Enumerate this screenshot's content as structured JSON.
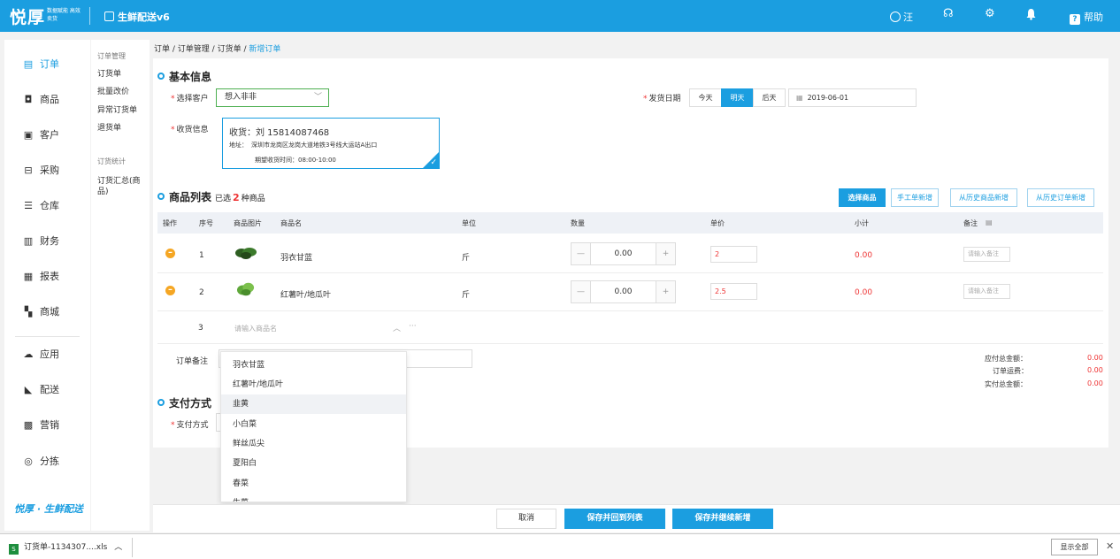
{
  "colors": {
    "brand": "#1b9ee0",
    "price_red": "#e33333",
    "remove_orange": "#f5a623",
    "selected_border": "#4caf50"
  },
  "topbar": {
    "logo": "悦厚",
    "logo_sub": "数据赋能 高效卖货",
    "app_title": "生鲜配送v6",
    "user_icon": "user-circle-icon",
    "user": "汪",
    "help": "帮助"
  },
  "sidebar": {
    "items": [
      {
        "label": "订单",
        "icon": "order-icon"
      },
      {
        "label": "商品",
        "icon": "bag-icon"
      },
      {
        "label": "客户",
        "icon": "contact-icon"
      },
      {
        "label": "采购",
        "icon": "cart-icon"
      },
      {
        "label": "仓库",
        "icon": "warehouse-icon"
      },
      {
        "label": "财务",
        "icon": "finance-icon"
      },
      {
        "label": "报表",
        "icon": "chart-icon"
      },
      {
        "label": "商城",
        "icon": "store-icon"
      },
      {
        "label": "应用",
        "icon": "cloud-icon"
      },
      {
        "label": "配送",
        "icon": "send-icon"
      },
      {
        "label": "营销",
        "icon": "marketing-icon"
      },
      {
        "label": "分拣",
        "icon": "sort-icon"
      }
    ],
    "brand": "悦厚 · 生鲜配送"
  },
  "subnav": {
    "group1": "订单管理",
    "items1": [
      "订货单",
      "批量改价",
      "异常订货单",
      "退货单"
    ],
    "group2": "订货统计",
    "items2": [
      "订货汇总(商品)"
    ]
  },
  "breadcrumb": [
    "订单",
    "订单管理",
    "订货单",
    "新增订单"
  ],
  "basic": {
    "title": "基本信息",
    "customer_label": "选择客户",
    "customer_value": "想入非非",
    "date_label": "发货日期",
    "date_options": [
      "今天",
      "明天",
      "后天"
    ],
    "date_selected": "明天",
    "date_value": "2019-06-01",
    "receive_label": "收货信息",
    "receiver": "收货：刘 15814087468",
    "address_label": "地址：",
    "address": "深圳市龙岗区龙岗大道地铁3号线大运站A出口",
    "expect_time": "期望收货时间：08:00-10:00"
  },
  "products": {
    "title": "商品列表",
    "selected_prefix": "已选",
    "selected_count": "2",
    "selected_suffix": "种商品",
    "buttons": [
      "选择商品",
      "手工单新增",
      "从历史商品新增",
      "从历史订单新增"
    ],
    "columns": [
      "操作",
      "序号",
      "商品图片",
      "商品名",
      "单位",
      "数量",
      "单价",
      "小计",
      "备注"
    ],
    "rows": [
      {
        "no": "1",
        "name": "羽衣甘蓝",
        "unit": "斤",
        "qty": "0.00",
        "price": "2",
        "subtotal": "0.00",
        "note_placeholder": "请输入备注"
      },
      {
        "no": "2",
        "name": "红薯叶/地瓜叶",
        "unit": "斤",
        "qty": "0.00",
        "price": "2.5",
        "subtotal": "0.00",
        "note_placeholder": "请输入备注"
      }
    ],
    "new_row_no": "3",
    "new_row_placeholder": "请输入商品名"
  },
  "dropdown": {
    "options": [
      "羽衣甘蓝",
      "红薯叶/地瓜叶",
      "韭黄",
      "小白菜",
      "鲜丝瓜尖",
      "夏阳白",
      "春菜",
      "生菜"
    ],
    "highlighted": "韭黄"
  },
  "order_note": {
    "label": "订单备注"
  },
  "totals": [
    {
      "label": "应付总金额：",
      "value": "0.00"
    },
    {
      "label": "订单运费：",
      "value": "0.00"
    },
    {
      "label": "实付总金额：",
      "value": "0.00"
    }
  ],
  "payment": {
    "title": "支付方式",
    "label": "支付方式"
  },
  "footer": {
    "cancel": "取消",
    "save_back": "保存并回到列表",
    "save_continue": "保存并继续新增"
  },
  "downloads": {
    "file": "订货单-1134307....xls",
    "show_all": "显示全部"
  }
}
